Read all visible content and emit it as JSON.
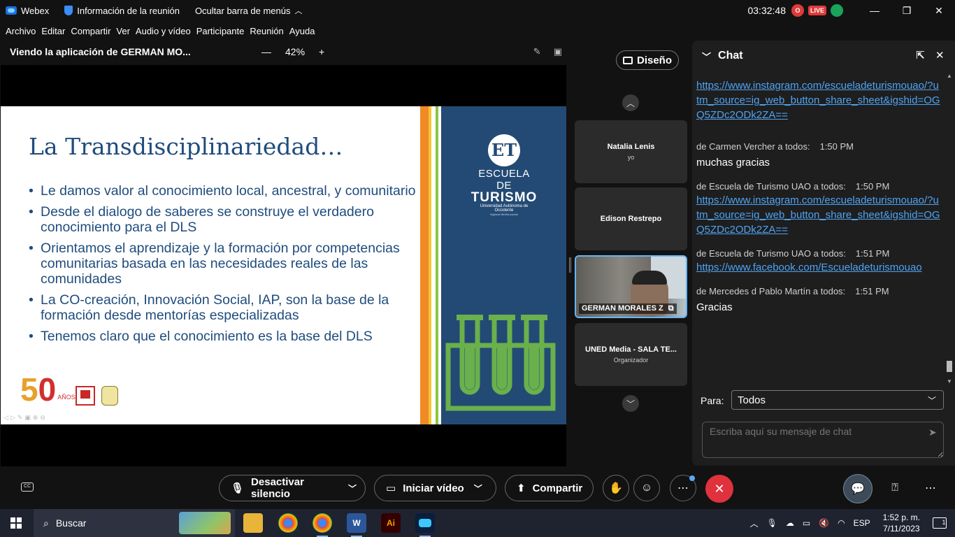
{
  "titlebar": {
    "app_name": "Webex",
    "meeting_info": "Información de la reunión",
    "hide_menu": "Ocultar barra de menús",
    "time": "03:32:48",
    "rec_letter": "O",
    "live": "LIVE",
    "minimize": "—",
    "restore": "❐",
    "close": "✕"
  },
  "menu": [
    "Archivo",
    "Editar",
    "Compartir",
    "Ver",
    "Audio y vídeo",
    "Participante",
    "Reunión",
    "Ayuda"
  ],
  "share": {
    "title": "Viendo la aplicación de GERMAN MO...",
    "zoom_minus": "—",
    "zoom": "42%",
    "zoom_plus": "+"
  },
  "slide": {
    "title": "La Transdisciplinariedad…",
    "bullets": [
      "Le damos valor al conocimiento local, ancestral, y comunitario",
      "Desde el dialogo de saberes se construye el verdadero conocimiento para el DLS",
      "Orientamos el aprendizaje y la formación por competencias comunitarias basada en las necesidades reales de las comunidades",
      "La CO-creación, Innovación Social, IAP, son la base de la formación desde mentorías especializadas",
      "Tenemos claro que el conocimiento es la base del DLS"
    ],
    "logo_mark": "ET",
    "logo_line1": "ESCUELA DE",
    "logo_line2": "TURISMO",
    "logo_line3": "Universidad Autónoma de Occidente",
    "logo_line4": "Vigilada MinEducación",
    "anniv_number_a": "5",
    "anniv_number_b": "0",
    "anniv_suffix": "AÑOS UAO"
  },
  "layout_button": "Diseño",
  "participants": [
    {
      "name": "Natalia Lenis",
      "sub": "yo"
    },
    {
      "name": "Edison Restrepo",
      "sub": ""
    },
    {
      "name": "GERMAN MORALES Z",
      "sub": ""
    },
    {
      "name": "UNED Media - SALA TE...",
      "sub": "Organizador"
    }
  ],
  "chat": {
    "title": "Chat",
    "messages": [
      {
        "meta_from": "",
        "meta_time": "",
        "link": "https://www.instagram.com/escueladeturismouao/?utm_source=ig_web_button_share_sheet&igshid=OGQ5ZDc2ODk2ZA==",
        "text": ""
      },
      {
        "meta_from": "de Carmen Vercher a todos:",
        "meta_time": "1:50 PM",
        "link": "",
        "text": "muchas gracias"
      },
      {
        "meta_from": "de Escuela de Turismo UAO a todos:",
        "meta_time": "1:50 PM",
        "link": "https://www.instagram.com/escueladeturismouao/?utm_source=ig_web_button_share_sheet&igshid=OGQ5ZDc2ODk2ZA==",
        "text": ""
      },
      {
        "meta_from": "de Escuela de Turismo UAO a todos:",
        "meta_time": "1:51 PM",
        "link": "https://www.facebook.com/Escueladeturismouao",
        "text": ""
      },
      {
        "meta_from": "de Mercedes d Pablo Martín a todos:",
        "meta_time": "1:51 PM",
        "link": "",
        "text": "Gracias"
      }
    ],
    "to_label": "Para:",
    "to_value": "Todos",
    "input_placeholder": "Escriba aquí su mensaje de chat"
  },
  "controls": {
    "mute": "Desactivar silencio",
    "video": "Iniciar vídeo",
    "share": "Compartir"
  },
  "taskbar": {
    "search": "Buscar",
    "lang": "ESP",
    "time": "1:52 p. m.",
    "date": "7/11/2023",
    "notif_count": "1"
  }
}
